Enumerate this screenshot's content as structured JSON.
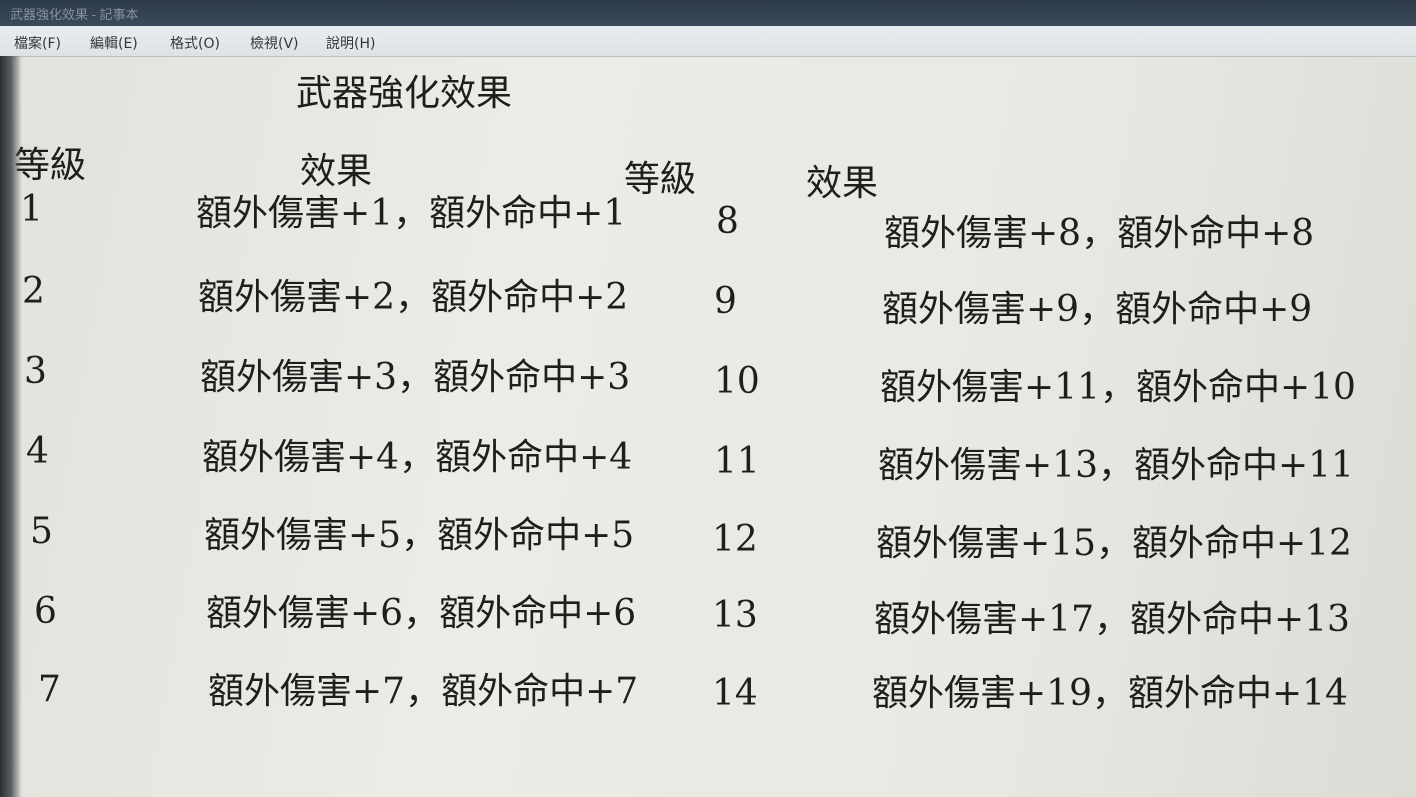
{
  "window": {
    "title": "武器強化效果 - 記事本"
  },
  "menu": {
    "items": [
      "檔案(F)",
      "編輯(E)",
      "格式(O)",
      "檢視(V)",
      "說明(H)"
    ]
  },
  "document": {
    "title": "武器強化效果",
    "headers": {
      "level_left": "等級",
      "effect_left": "效果",
      "level_right": "等級",
      "effect_right": "效果"
    },
    "left_rows": [
      {
        "level": "1",
        "effect": "額外傷害+1，額外命中+1"
      },
      {
        "level": "2",
        "effect": "額外傷害+2，額外命中+2"
      },
      {
        "level": "3",
        "effect": "額外傷害+3，額外命中+3"
      },
      {
        "level": "4",
        "effect": "額外傷害+4，額外命中+4"
      },
      {
        "level": "5",
        "effect": "額外傷害+5，額外命中+5"
      },
      {
        "level": "6",
        "effect": "額外傷害+6，額外命中+6"
      },
      {
        "level": "7",
        "effect": "額外傷害+7，額外命中+7"
      }
    ],
    "right_rows": [
      {
        "level": "8",
        "effect": "額外傷害+8，額外命中+8"
      },
      {
        "level": "9",
        "effect": "額外傷害+9，額外命中+9"
      },
      {
        "level": "10",
        "effect": "額外傷害+11，額外命中+10"
      },
      {
        "level": "11",
        "effect": "額外傷害+13，額外命中+11"
      },
      {
        "level": "12",
        "effect": "額外傷害+15，額外命中+12"
      },
      {
        "level": "13",
        "effect": "額外傷害+17，額外命中+13"
      },
      {
        "level": "14",
        "effect": "額外傷害+19，額外命中+14"
      }
    ]
  }
}
